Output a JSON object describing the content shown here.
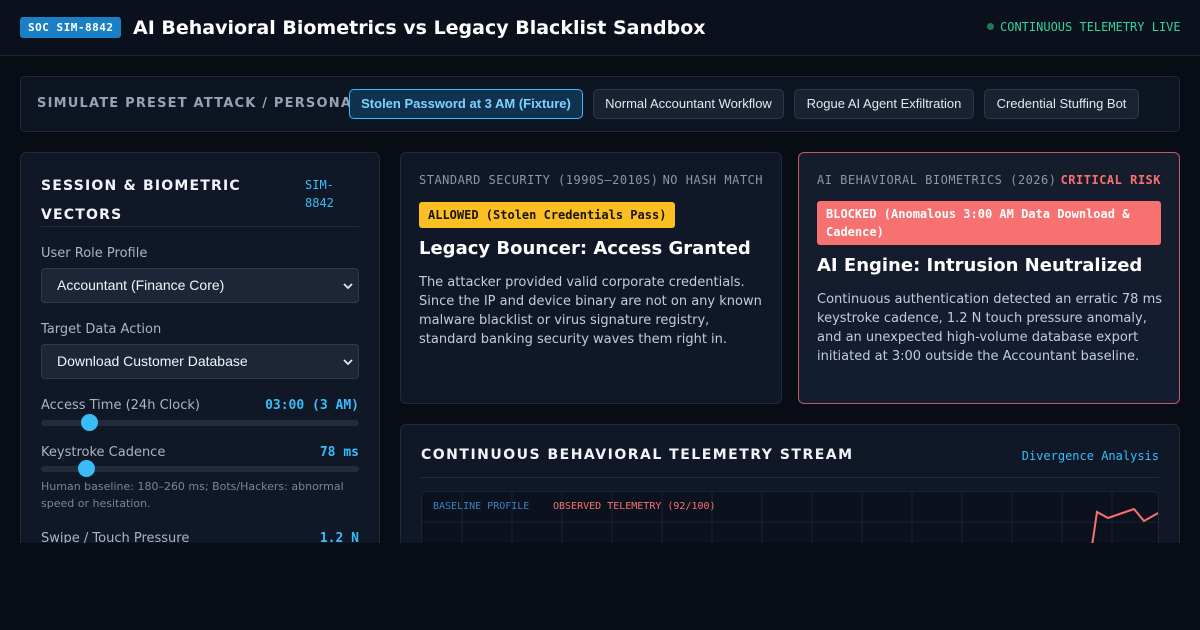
{
  "header": {
    "badge": "SOC SIM-8842",
    "title": "AI Behavioral Biometrics vs Legacy Blacklist Sandbox",
    "status": "CONTINUOUS TELEMETRY LIVE"
  },
  "presets": {
    "label": "SIMULATE PRESET ATTACK / PERSONA:",
    "items": [
      {
        "label": "Stolen Password at 3 AM (Fixture)",
        "active": true
      },
      {
        "label": "Normal Accountant Workflow",
        "active": false
      },
      {
        "label": "Rogue AI Agent Exfiltration",
        "active": false
      },
      {
        "label": "Credential Stuffing Bot",
        "active": false
      }
    ]
  },
  "session": {
    "title": "SESSION & BIOMETRIC VECTORS",
    "id": "SIM-8842",
    "role_label": "User Role Profile",
    "role_value": "Accountant (Finance Core)",
    "action_label": "Target Data Action",
    "action_value": "Download Customer Database",
    "access_time_label": "Access Time (24h Clock)",
    "access_time_value": "03:00 (3 AM)",
    "access_time_fraction": 0.15,
    "keystroke_label": "Keystroke Cadence",
    "keystroke_value": "78 ms",
    "keystroke_fraction": 0.14,
    "keystroke_hint": "Human baseline: 180–260 ms; Bots/Hackers: abnormal speed or hesitation.",
    "pressure_label": "Swipe / Touch Pressure",
    "pressure_value": "1.2 N"
  },
  "legacy": {
    "eyebrow": "STANDARD SECURITY (1990S–2010S)",
    "flag": "NO HASH MATCH",
    "pill": "ALLOWED (Stolen Credentials Pass)",
    "heading": "Legacy Bouncer: Access Granted",
    "body": "The attacker provided valid corporate credentials. Since the IP and device binary are not on any known malware blacklist or virus signature registry, standard banking security waves them right in."
  },
  "ai": {
    "eyebrow": "AI BEHAVIORAL BIOMETRICS (2026)",
    "flag": "CRITICAL RISK",
    "pill": "BLOCKED (Anomalous 3:00 AM Data Download & Cadence)",
    "heading": "AI Engine: Intrusion Neutralized",
    "body": "Continuous authentication detected an erratic 78 ms keystroke cadence, 1.2 N touch pressure anomaly, and an unexpected high-volume database export initiated at 3:00 outside the Accountant baseline."
  },
  "telemetry": {
    "title": "CONTINUOUS BEHAVIORAL TELEMETRY STREAM",
    "link": "Divergence Analysis",
    "legend_baseline": "BASELINE PROFILE",
    "legend_observed": "OBSERVED TELEMETRY (92/100)"
  },
  "colors": {
    "accent": "#38bdf8",
    "allowed": "#fbbf24",
    "blocked": "#f87171",
    "live": "#34d399"
  }
}
